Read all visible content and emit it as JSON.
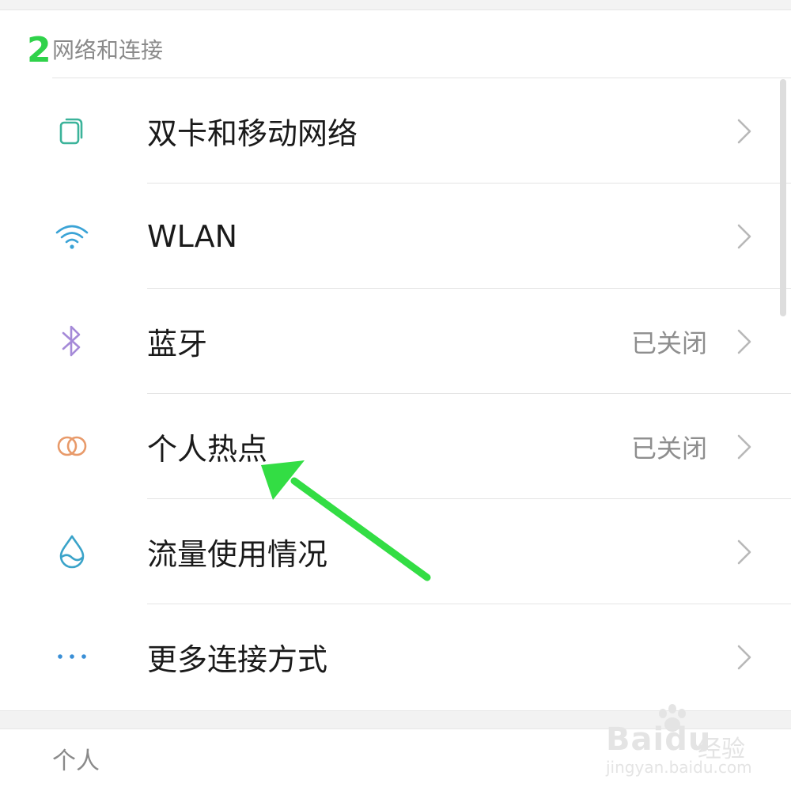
{
  "section": {
    "step_number": "2",
    "title": "网络和连接"
  },
  "items": [
    {
      "label": "双卡和移动网络",
      "status": "",
      "icon": "dual-sim-icon",
      "icon_color": "#3bb39a"
    },
    {
      "label": "WLAN",
      "status": "",
      "icon": "wifi-icon",
      "icon_color": "#3aa3d6"
    },
    {
      "label": "蓝牙",
      "status": "已关闭",
      "icon": "bluetooth-icon",
      "icon_color": "#a58ad8"
    },
    {
      "label": "个人热点",
      "status": "已关闭",
      "icon": "hotspot-icon",
      "icon_color": "#e89a6a"
    },
    {
      "label": "流量使用情况",
      "status": "",
      "icon": "data-usage-icon",
      "icon_color": "#3aa3c9"
    },
    {
      "label": "更多连接方式",
      "status": "",
      "icon": "more-icon",
      "icon_color": "#3a8fd6"
    }
  ],
  "next_section": {
    "title": "个人"
  },
  "annotation": {
    "arrow_color": "#33dd44",
    "points_to": "个人热点"
  },
  "watermark": {
    "brand": "Bai",
    "brand2": "du",
    "text": "经验",
    "url": "jingyan.baidu.com"
  }
}
